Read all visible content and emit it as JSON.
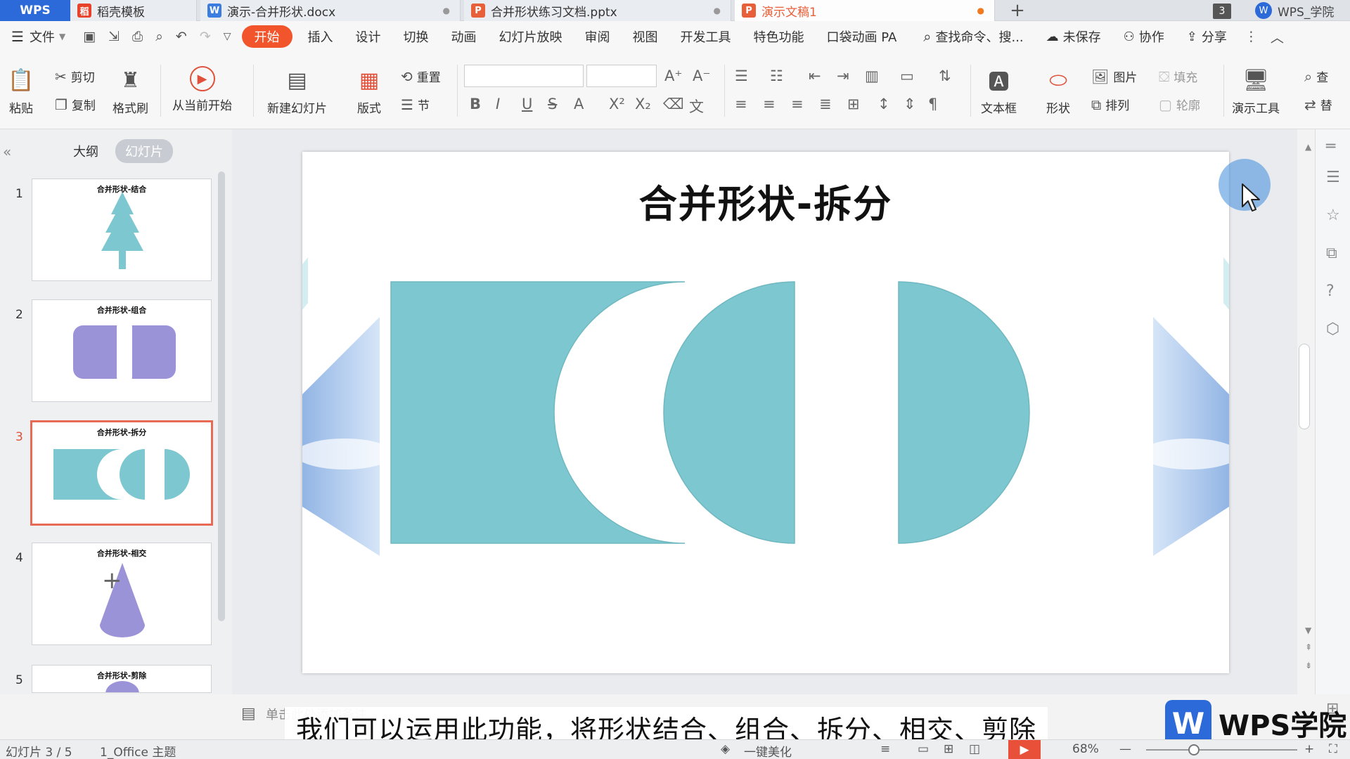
{
  "tabs": {
    "app": "WPS",
    "template": "稻壳模板",
    "doc1": "演示-合并形状.docx",
    "doc2": "合并形状练习文档.pptx",
    "doc3": "演示文稿1",
    "count": "3",
    "user": "WPS_学院"
  },
  "menu": {
    "file": "文件",
    "items": [
      "开始",
      "插入",
      "设计",
      "切换",
      "动画",
      "幻灯片放映",
      "审阅",
      "视图",
      "开发工具",
      "特色功能",
      "口袋动画 PA"
    ],
    "search": "查找命令、搜...",
    "unsaved": "未保存",
    "collab": "协作",
    "share": "分享"
  },
  "ribbon": {
    "paste": "粘贴",
    "cut": "剪切",
    "copy": "复制",
    "format_painter": "格式刷",
    "from_current": "从当前开始",
    "new_slide": "新建幻灯片",
    "layout": "版式",
    "reset": "重置",
    "section": "节",
    "textbox": "文本框",
    "shapes": "形状",
    "picture": "图片",
    "arrange": "排列",
    "fill": "填充",
    "outline": "轮廓",
    "present_tools": "演示工具",
    "find": "查",
    "replace": "替"
  },
  "panel": {
    "outline": "大纲",
    "slides": "幻灯片",
    "thumbs": [
      {
        "num": "1",
        "title": "合并形状-结合"
      },
      {
        "num": "2",
        "title": "合并形状-组合"
      },
      {
        "num": "3",
        "title": "合并形状-拆分"
      },
      {
        "num": "4",
        "title": "合并形状-相交"
      },
      {
        "num": "5",
        "title": "合并形状-剪除"
      }
    ]
  },
  "slide": {
    "title": "合并形状-拆分",
    "shape_color": "#7cc7d0"
  },
  "notes_hint": "单击此处添加备注",
  "subtitle": "我们可以运用此功能，将形状结合、组合、拆分、相交、剪除",
  "brand": "WPS学院",
  "status": {
    "slide_info": "幻灯片 3 / 5",
    "theme": "1_Office 主题",
    "beautify": "一键美化",
    "zoom": "68%"
  }
}
